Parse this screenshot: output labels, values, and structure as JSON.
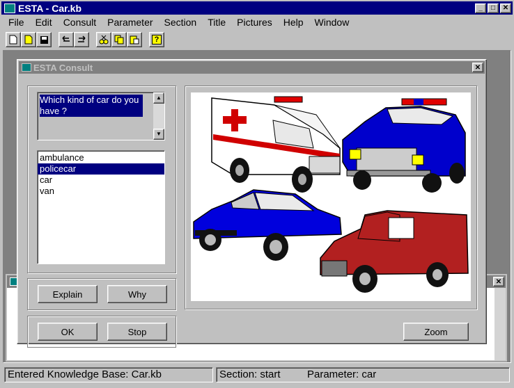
{
  "app": {
    "title": "ESTA - Car.kb",
    "menu": [
      "File",
      "Edit",
      "Consult",
      "Parameter",
      "Section",
      "Title",
      "Pictures",
      "Help",
      "Window"
    ]
  },
  "toolbar": {
    "buttons": [
      "new",
      "open",
      "save",
      "undo",
      "redo",
      "cut",
      "copy",
      "paste",
      "help"
    ],
    "help_glyph": "?"
  },
  "consult": {
    "title": "ESTA Consult",
    "question": "Which kind of car do you have ?",
    "options": [
      "ambulance",
      "policecar",
      "car",
      "van"
    ],
    "selected_option": "policecar",
    "buttons": {
      "explain": "Explain",
      "why": "Why",
      "ok": "OK",
      "stop": "Stop",
      "zoom": "Zoom"
    },
    "picture_alt": "cars"
  },
  "statusbar": {
    "knowledge_base": "Entered Knowledge Base:  Car.kb",
    "section": "Section: start",
    "parameter": "Parameter: car"
  },
  "colors": {
    "title_active": "#000080",
    "title_inactive": "#808080",
    "selection": "#000080",
    "face": "#c0c0c0"
  }
}
